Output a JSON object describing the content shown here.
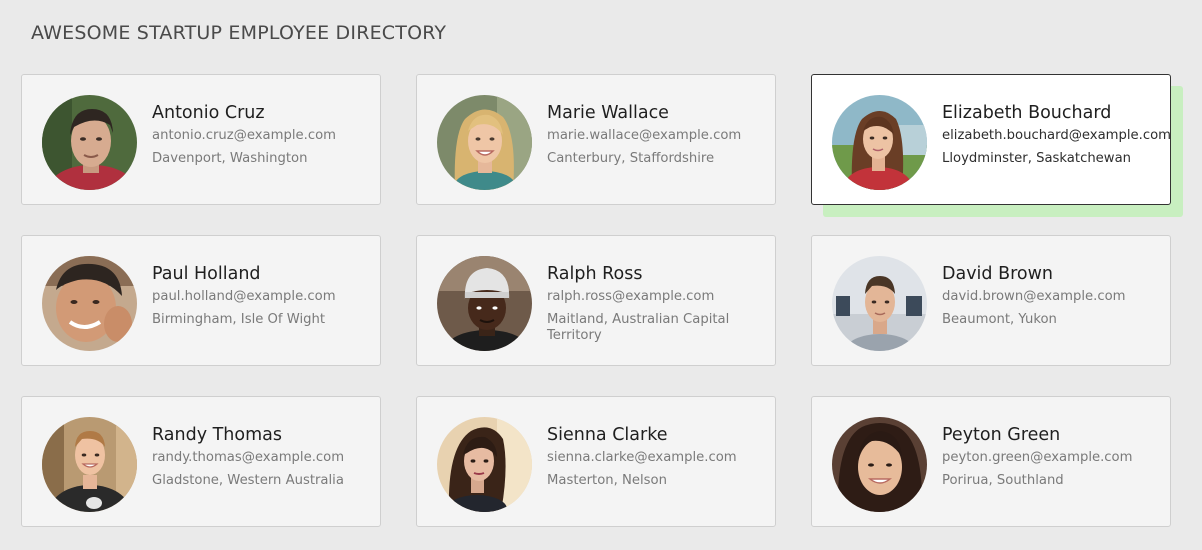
{
  "header": {
    "title": "AWESOME STARTUP EMPLOYEE DIRECTORY"
  },
  "colors": {
    "page_background": "#eaeaea",
    "card_background": "#f4f4f4",
    "selected_card_background": "#ffffff",
    "selected_card_border": "#333333",
    "selected_card_shadow": "#c8efc0"
  },
  "employees": [
    {
      "name": "Antonio Cruz",
      "email": "antonio.cruz@example.com",
      "location": "Davenport, Washington",
      "selected": false
    },
    {
      "name": "Marie Wallace",
      "email": "marie.wallace@example.com",
      "location": "Canterbury, Staffordshire",
      "selected": false
    },
    {
      "name": "Elizabeth Bouchard",
      "email": "elizabeth.bouchard@example.com",
      "location": "Lloydminster, Saskatchewan",
      "selected": true
    },
    {
      "name": "Paul Holland",
      "email": "paul.holland@example.com",
      "location": "Birmingham, Isle Of Wight",
      "selected": false
    },
    {
      "name": "Ralph Ross",
      "email": "ralph.ross@example.com",
      "location": "Maitland, Australian Capital Territory",
      "selected": false
    },
    {
      "name": "David Brown",
      "email": "david.brown@example.com",
      "location": "Beaumont, Yukon",
      "selected": false
    },
    {
      "name": "Randy Thomas",
      "email": "randy.thomas@example.com",
      "location": "Gladstone, Western Australia",
      "selected": false
    },
    {
      "name": "Sienna Clarke",
      "email": "sienna.clarke@example.com",
      "location": "Masterton, Nelson",
      "selected": false
    },
    {
      "name": "Peyton Green",
      "email": "peyton.green@example.com",
      "location": "Porirua, Southland",
      "selected": false
    }
  ]
}
